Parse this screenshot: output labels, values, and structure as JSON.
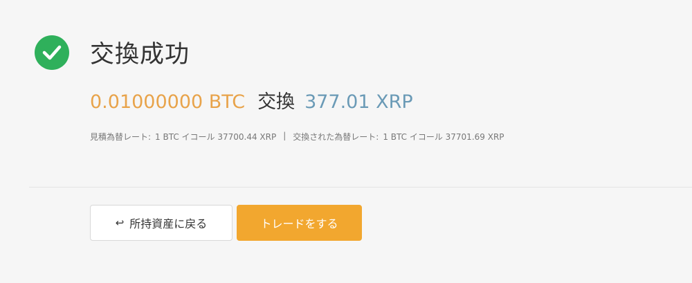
{
  "header": {
    "title": "交換成功",
    "icon": "check-circle-icon",
    "icon_color": "#2fb05b"
  },
  "exchange": {
    "from_amount": "0.01000000 BTC",
    "word": "交換",
    "to_amount": "377.01 XRP",
    "from_color": "#e8a34a",
    "to_color": "#6a9ab6"
  },
  "rates": {
    "estimated_label": "見積為替レート:",
    "estimated_value": "1 BTC イコール 37700.44 XRP",
    "separator": "|",
    "actual_label": "交換された為替レート:",
    "actual_value": "1 BTC イコール 37701.69 XRP"
  },
  "actions": {
    "back_arrow": "↩",
    "back_label": "所持資産に戻る",
    "trade_label": "トレードをする",
    "trade_color": "#f2a72f"
  }
}
